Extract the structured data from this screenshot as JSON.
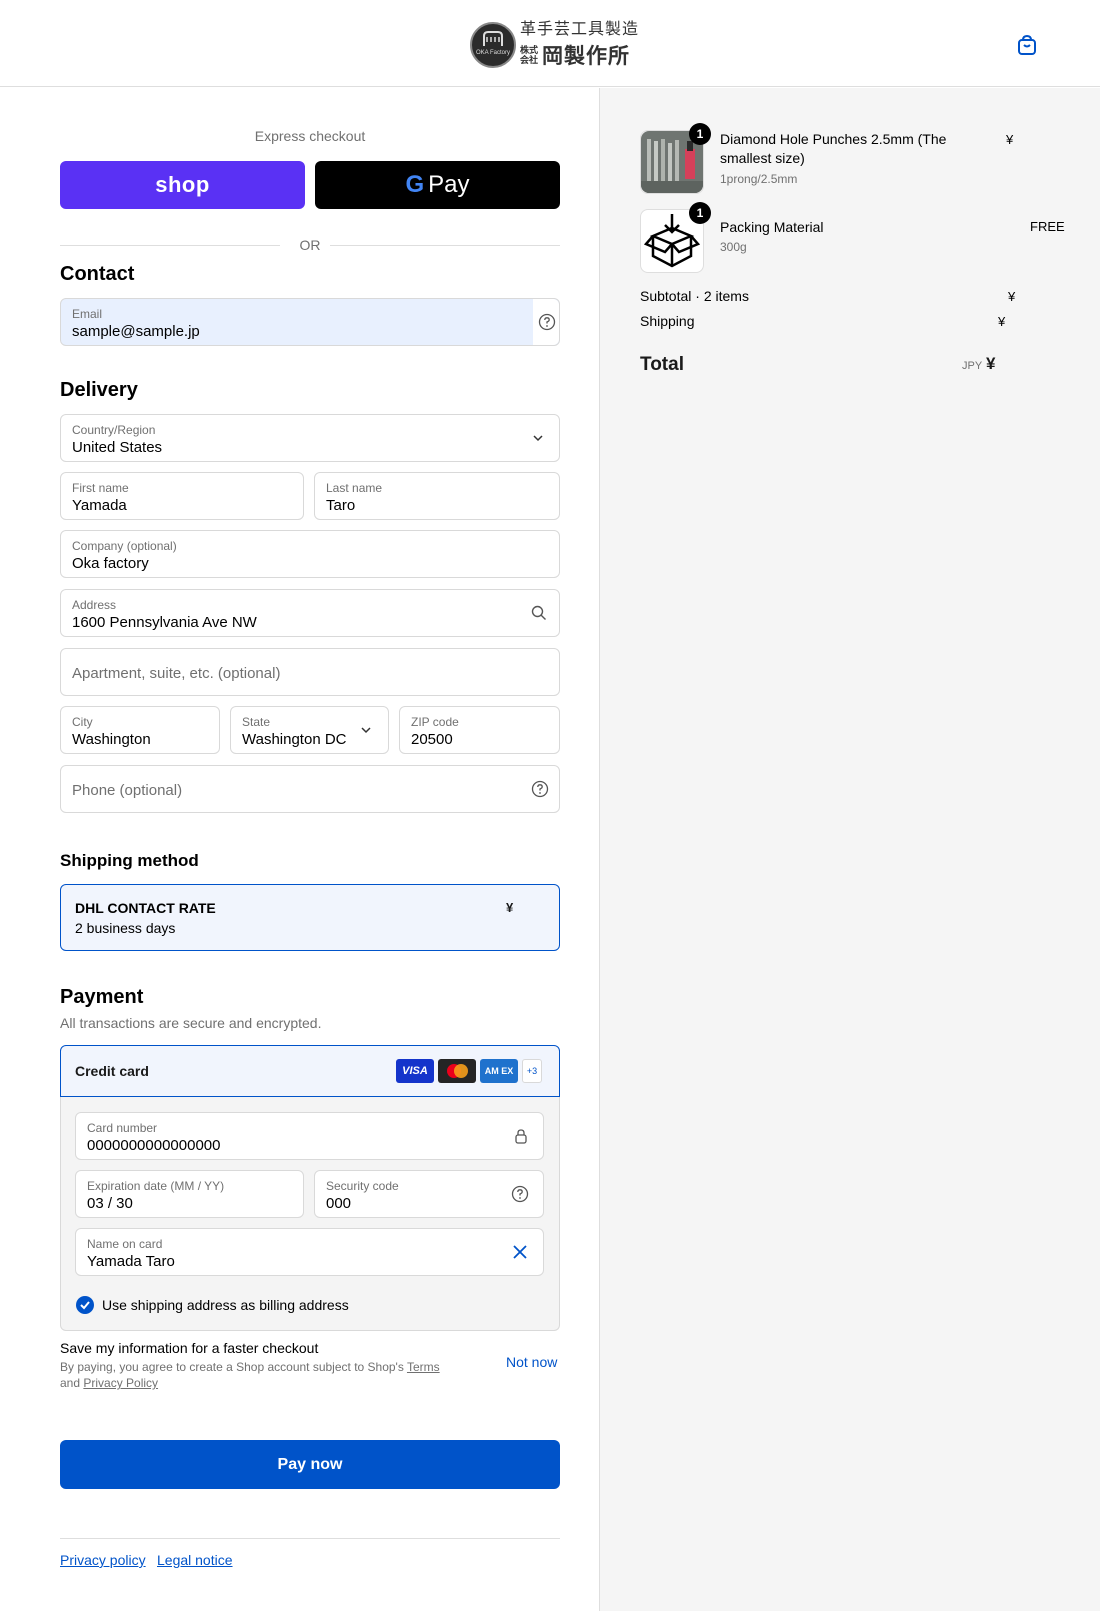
{
  "header": {
    "logo_line1": "革手芸工具製造",
    "logo_small": "株式会社",
    "logo_big": "岡製作所",
    "logo_mark_text": "OKA Factory"
  },
  "express": {
    "title": "Express checkout",
    "shop_label": "shop",
    "gpay_g": "G",
    "gpay_label": "Pay",
    "or": "OR"
  },
  "contact": {
    "heading": "Contact",
    "email_label": "Email",
    "email_value": "sample@sample.jp"
  },
  "delivery": {
    "heading": "Delivery",
    "country_label": "Country/Region",
    "country_value": "United States",
    "first_label": "First name",
    "first_value": "Yamada",
    "last_label": "Last name",
    "last_value": "Taro",
    "company_label": "Company (optional)",
    "company_value": "Oka factory",
    "address_label": "Address",
    "address_value": "1600 Pennsylvania Ave NW",
    "apt_placeholder": "Apartment, suite, etc. (optional)",
    "city_label": "City",
    "city_value": "Washington",
    "state_label": "State",
    "state_value": "Washington DC",
    "zip_label": "ZIP code",
    "zip_value": "20500",
    "phone_placeholder": "Phone (optional)"
  },
  "shipping_method": {
    "heading": "Shipping method",
    "name": "DHL CONTACT RATE",
    "time": "2 business days",
    "price": "¥"
  },
  "payment": {
    "heading": "Payment",
    "subtitle": "All transactions are secure and encrypted.",
    "method": "Credit card",
    "card_visa": "VISA",
    "card_amex": "AM EX",
    "card_more": "+3",
    "card_number_label": "Card number",
    "card_number_value": "0000000000000000",
    "expiry_label": "Expiration date (MM / YY)",
    "expiry_value": "03 / 30",
    "cvc_label": "Security code",
    "cvc_value": "000",
    "name_label": "Name on card",
    "name_value": "Yamada Taro",
    "billing_same": "Use shipping address as billing address"
  },
  "save": {
    "title": "Save my information for a faster checkout",
    "sub_prefix": "By paying, you agree to create a Shop account subject to Shop's ",
    "terms": "Terms",
    "and": " and ",
    "privacy": "Privacy Policy",
    "not_now": "Not now"
  },
  "pay_button": "Pay now",
  "footer": {
    "privacy": "Privacy policy",
    "legal": "Legal notice"
  },
  "summary": {
    "items": [
      {
        "name": "Diamond Hole Punches 2.5mm (The smallest size)",
        "variant": "1prong/2.5mm",
        "price": "¥",
        "qty": "1",
        "icon": "hole-punches-photo"
      },
      {
        "name": "Packing Material",
        "variant": "300g",
        "price": "FREE",
        "qty": "1",
        "icon": "box-icon"
      }
    ],
    "subtotal_label": "Subtotal · 2 items",
    "subtotal_value": "¥",
    "shipping_label": "Shipping",
    "shipping_value": "¥",
    "total_label": "Total",
    "total_currency": "JPY",
    "total_value": "¥"
  },
  "colors": {
    "accent": "#0053c9",
    "shop_purple": "#5a31f4",
    "summary_bg": "#f5f5f5"
  }
}
